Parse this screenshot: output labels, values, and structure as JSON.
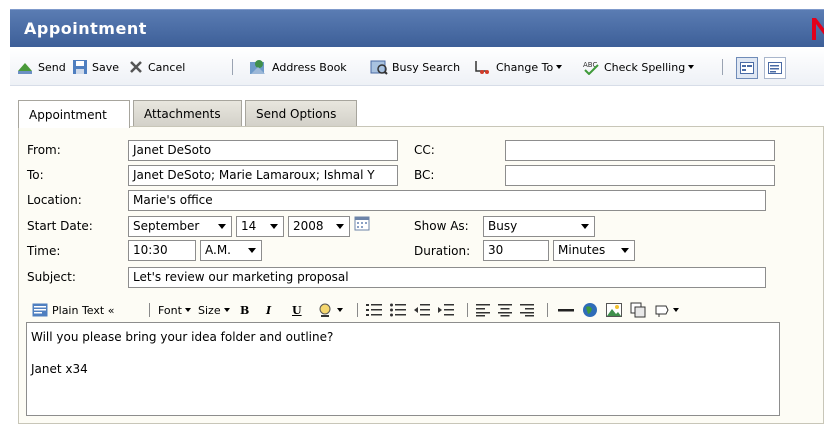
{
  "window": {
    "title": "Appointment"
  },
  "toolbar": {
    "send": "Send",
    "save": "Save",
    "cancel": "Cancel",
    "address_book": "Address Book",
    "busy_search": "Busy Search",
    "change_to": "Change To",
    "check_spelling": "Check Spelling"
  },
  "tabs": [
    "Appointment",
    "Attachments",
    "Send Options"
  ],
  "form": {
    "from_label": "From:",
    "from_value": "Janet DeSoto",
    "to_label": "To:",
    "to_value": "Janet DeSoto;  Marie Lamaroux; Ishmal Y",
    "cc_label": "CC:",
    "cc_value": "",
    "bc_label": "BC:",
    "bc_value": "",
    "location_label": "Location:",
    "location_value": "Marie's office",
    "start_date_label": "Start Date:",
    "start_month": "September",
    "start_day": "14",
    "start_year": "2008",
    "show_as_label": "Show As:",
    "show_as_value": "Busy",
    "time_label": "Time:",
    "time_value": "10:30",
    "ampm_value": "A.M.",
    "duration_label": "Duration:",
    "duration_value": "30",
    "duration_unit": "Minutes",
    "subject_label": "Subject:",
    "subject_value": "Let's review our marketing proposal"
  },
  "editor_toolbar": {
    "plain_text": "Plain Text «",
    "font": "Font",
    "size": "Size",
    "bold": "B",
    "italic": "I",
    "underline": "U"
  },
  "message": {
    "line1": "Will you please bring your idea folder and outline?",
    "line2": "",
    "line3": "Janet x34"
  },
  "colors": {
    "titlebar": "#4a6ba5",
    "brand_red": "#e2001a",
    "panel_bg": "#fdfcf5"
  }
}
